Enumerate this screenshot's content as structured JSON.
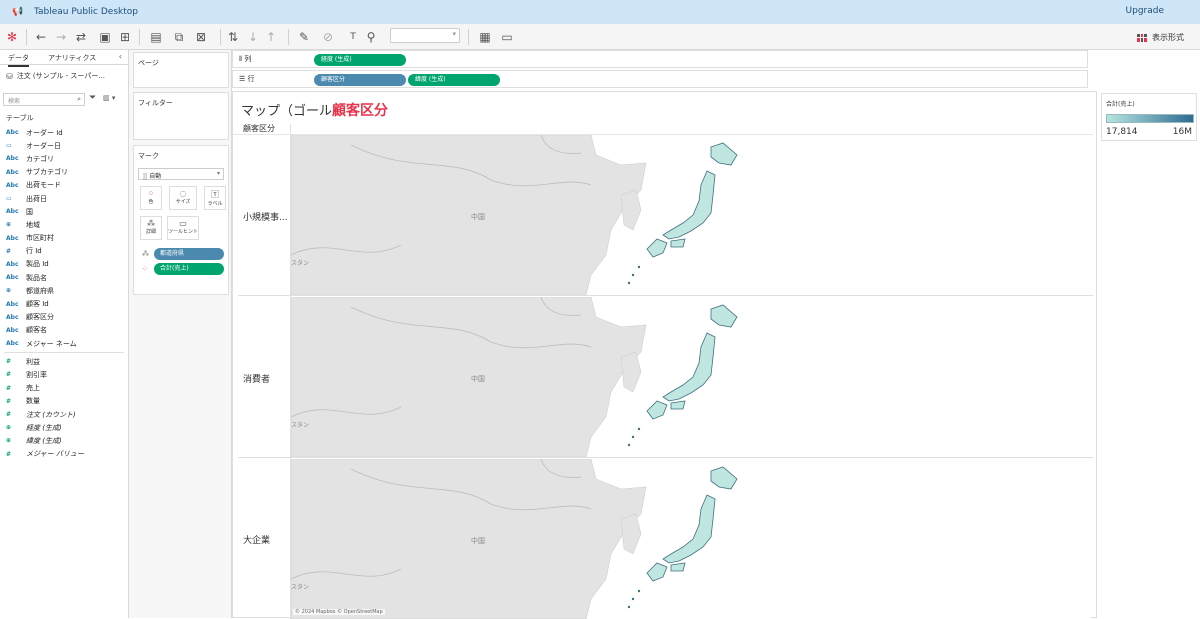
{
  "titlebar": {
    "app_title": "Tableau Public Desktop",
    "upgrade": "Upgrade",
    "app_icon": "megaphone-icon"
  },
  "toolbar": {
    "show_me": "表示形式"
  },
  "data_pane": {
    "tabs": [
      "データ",
      "アナリティクス"
    ],
    "datasource": "注文 (サンプル - スーパー...",
    "search_placeholder": "検索",
    "table_heading": "テーブル",
    "dimensions": [
      {
        "icon": "Abc",
        "name": "オーダー Id"
      },
      {
        "icon": "▭",
        "name": "オーダー日"
      },
      {
        "icon": "Abc",
        "name": "カテゴリ"
      },
      {
        "icon": "Abc",
        "name": "サブカテゴリ"
      },
      {
        "icon": "Abc",
        "name": "出荷モード"
      },
      {
        "icon": "▭",
        "name": "出荷日"
      },
      {
        "icon": "Abc",
        "name": "国"
      },
      {
        "icon": "⊕",
        "name": "地域"
      },
      {
        "icon": "Abc",
        "name": "市区町村"
      },
      {
        "icon": "#",
        "name": "行 Id"
      },
      {
        "icon": "Abc",
        "name": "製品 Id"
      },
      {
        "icon": "Abc",
        "name": "製品名"
      },
      {
        "icon": "⊕",
        "name": "都道府県"
      },
      {
        "icon": "Abc",
        "name": "顧客 Id"
      },
      {
        "icon": "Abc",
        "name": "顧客区分"
      },
      {
        "icon": "Abc",
        "name": "顧客名"
      },
      {
        "icon": "Abc",
        "name": "メジャー ネーム"
      }
    ],
    "measures": [
      {
        "icon": "#",
        "name": "利益",
        "italic": false
      },
      {
        "icon": "#",
        "name": "割引率",
        "italic": false
      },
      {
        "icon": "#",
        "name": "売上",
        "italic": false
      },
      {
        "icon": "#",
        "name": "数量",
        "italic": false
      },
      {
        "icon": "#",
        "name": "注文 (カウント)",
        "italic": true
      },
      {
        "icon": "⊕",
        "name": "経度 (生成)",
        "italic": true
      },
      {
        "icon": "⊕",
        "name": "緯度 (生成)",
        "italic": true
      },
      {
        "icon": "#",
        "name": "メジャー バリュー",
        "italic": true
      }
    ]
  },
  "cards": {
    "pages": "ページ",
    "filters": "フィルター",
    "marks": "マーク",
    "mark_type": "自動",
    "buttons": [
      "色",
      "サイズ",
      "ラベル",
      "詳細",
      "ツールヒント"
    ],
    "pills": [
      "都道府県",
      "合計(売上)"
    ]
  },
  "shelves": {
    "columns_label": "列",
    "rows_label": "行",
    "columns_pills": [
      "経度 (生成)"
    ],
    "rows_pills": [
      "顧客区分",
      "緯度 (生成)"
    ]
  },
  "viz": {
    "title_prefix": "マップ（ゴール",
    "title_highlight": "顧客区分",
    "header": "顧客区分",
    "rows": [
      "小規模事...",
      "消費者",
      "大企業"
    ],
    "map_labels": {
      "china": "中国",
      "stan": "スタン"
    },
    "attribution": "© 2024 Mapbox © OpenStreetMap"
  },
  "legend": {
    "title": "合計(売上)",
    "min": "17,814",
    "max": "16M"
  },
  "colors": {
    "accent": "#e8334a",
    "pill_blue": "#4b8aae",
    "pill_green": "#00a46e",
    "legend_low": "#b6e5e0",
    "legend_high": "#2f6b93"
  }
}
